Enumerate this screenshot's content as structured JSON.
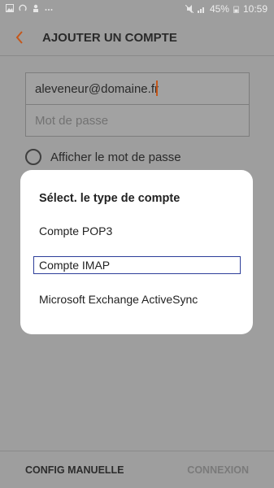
{
  "status_bar": {
    "battery": "45%",
    "time": "10:59",
    "left_icons": [
      "gallery-icon",
      "sync-icon",
      "person-icon",
      "more-dots-icon"
    ],
    "right_icons": [
      "mute-icon",
      "signal-icon",
      "battery-icon"
    ]
  },
  "app_bar": {
    "title": "AJOUTER UN COMPTE",
    "back_icon": "chevron-left-icon",
    "accent_color": "#c4571b"
  },
  "form": {
    "email_value": "aleveneur@domaine.fr",
    "password_placeholder": "Mot de passe",
    "show_password_label": "Afficher le mot de passe"
  },
  "dialog": {
    "title": "Sélect. le type de compte",
    "options": [
      {
        "label": "Compte POP3",
        "focused": false
      },
      {
        "label": "Compte IMAP",
        "focused": true
      },
      {
        "label": "Microsoft Exchange ActiveSync",
        "focused": false
      }
    ],
    "focus_color": "#2d3e9a"
  },
  "bottom": {
    "config_label": "CONFIG MANUELLE",
    "connexion_label": "CONNEXION"
  }
}
